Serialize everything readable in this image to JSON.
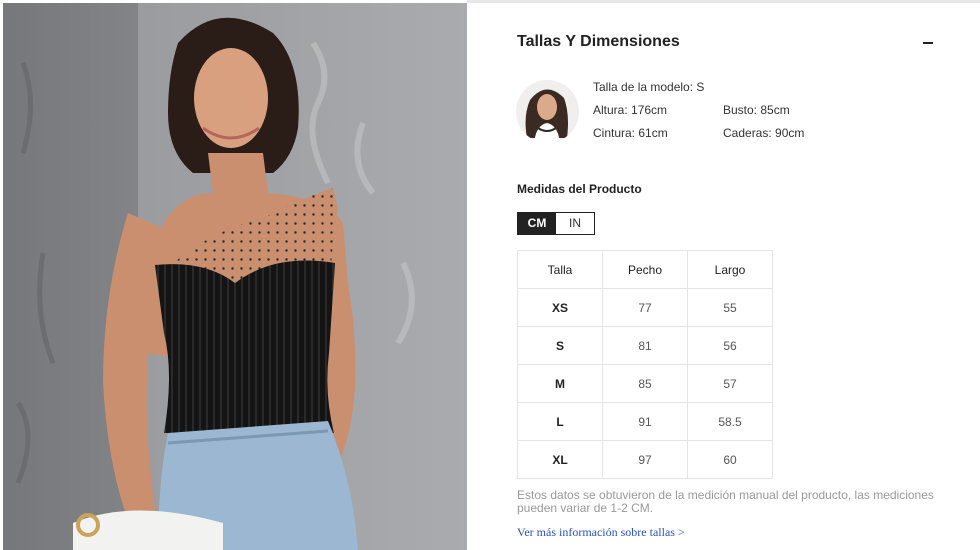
{
  "section": {
    "title": "Tallas Y Dimensiones",
    "collapse_icon": "minus-icon"
  },
  "model": {
    "size": "Talla de la modelo: S",
    "height": "Altura: 176cm",
    "bust": "Busto: 85cm",
    "waist": "Cintura: 61cm",
    "hips": "Caderas: 90cm"
  },
  "product": {
    "title": "Medidas del Producto",
    "units": [
      "CM",
      "IN"
    ],
    "selected_unit": "CM"
  },
  "table": {
    "headers": [
      "Talla",
      "Pecho",
      "Largo"
    ],
    "rows": [
      {
        "size": "XS",
        "pecho": "77",
        "largo": "55"
      },
      {
        "size": "S",
        "pecho": "81",
        "largo": "56"
      },
      {
        "size": "M",
        "pecho": "85",
        "largo": "57"
      },
      {
        "size": "L",
        "pecho": "91",
        "largo": "58.5"
      },
      {
        "size": "XL",
        "pecho": "97",
        "largo": "60"
      }
    ]
  },
  "note": "Estos datos se obtuvieron de la medición manual del producto, las mediciones pueden variar de 1-2 CM.",
  "more_link": "Ver más información sobre tallas >",
  "colors": {
    "accent": "#222222",
    "link": "#2a52be",
    "note": "#999999",
    "border": "#e5e5e5"
  }
}
